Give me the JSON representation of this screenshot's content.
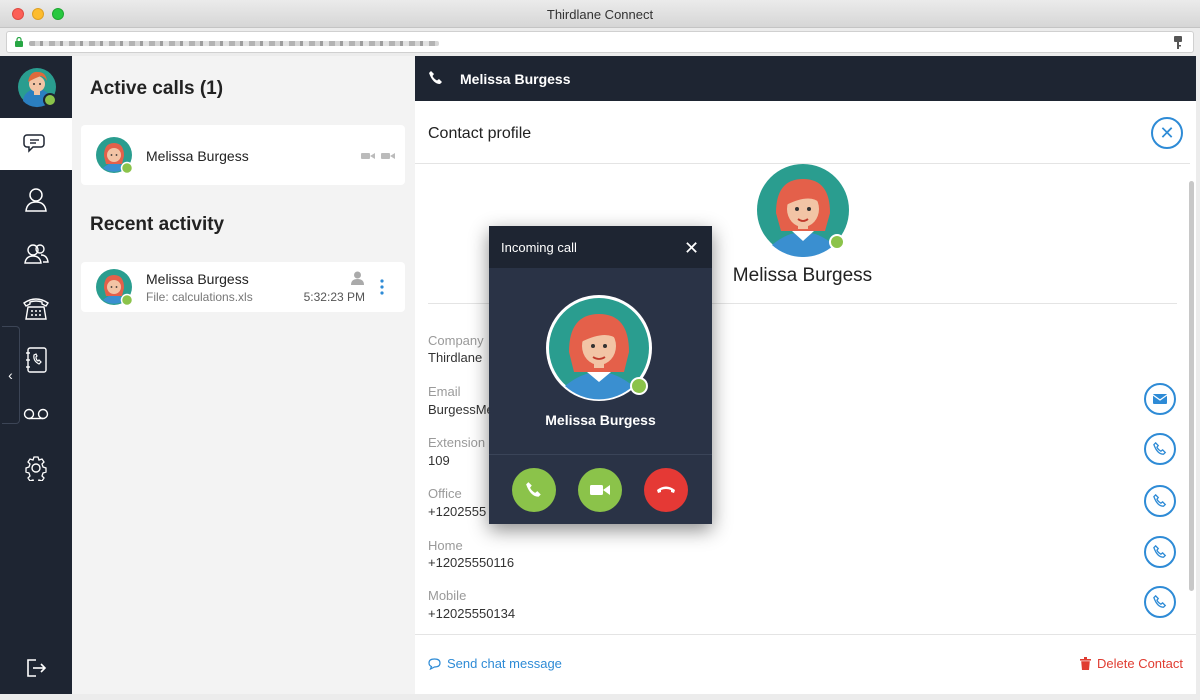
{
  "window": {
    "title": "Thirdlane Connect"
  },
  "active_calls": {
    "title": "Active calls (1)",
    "items": [
      {
        "name": "Melissa Burgess"
      }
    ]
  },
  "recent_activity": {
    "title": "Recent activity",
    "items": [
      {
        "name": "Melissa Burgess",
        "detail": "File: calculations.xls",
        "time": "5:32:23 PM"
      }
    ]
  },
  "call_header": {
    "name": "Melissa Burgess"
  },
  "profile": {
    "title": "Contact profile",
    "name": "Melissa Burgess",
    "fields": [
      {
        "label": "Company",
        "value": "Thirdlane"
      },
      {
        "label": "Email",
        "value": "BurgessMe"
      },
      {
        "label": "Extension",
        "value": "109"
      },
      {
        "label": "Office",
        "value": "+1202555"
      },
      {
        "label": "Home",
        "value": "+12025550116"
      },
      {
        "label": "Mobile",
        "value": "+12025550134"
      }
    ],
    "send_chat": "Send chat message",
    "delete_contact": "Delete Contact"
  },
  "incoming_call": {
    "title": "Incoming call",
    "name": "Melissa Burgess"
  },
  "colors": {
    "sidebar": "#1e2532",
    "accent": "#2e8bd6",
    "online": "#8bc34a",
    "accept": "#8bc34a",
    "decline": "#e53935",
    "danger": "#e03c31"
  }
}
